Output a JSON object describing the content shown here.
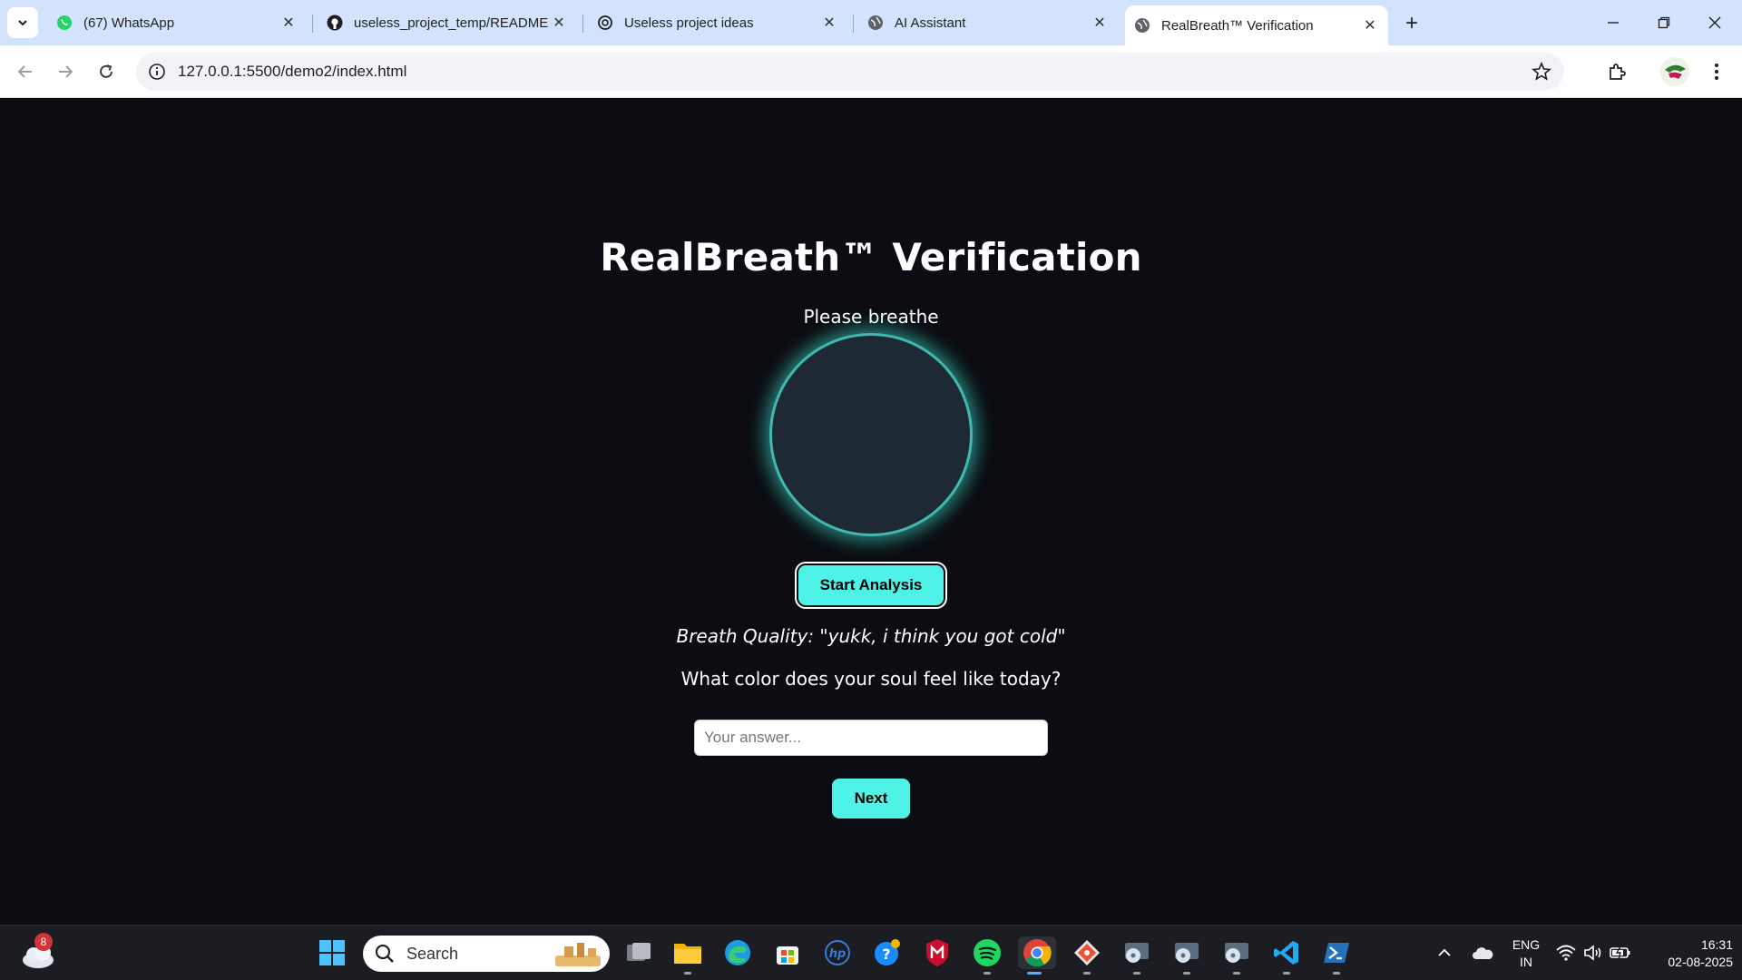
{
  "browser": {
    "tabs": [
      {
        "title": "(67) WhatsApp",
        "icon": "whatsapp-icon"
      },
      {
        "title": "useless_project_temp/README",
        "icon": "github-icon"
      },
      {
        "title": "Useless project ideas",
        "icon": "openai-icon"
      },
      {
        "title": "AI Assistant",
        "icon": "globe-icon"
      },
      {
        "title": "RealBreath™ Verification",
        "icon": "globe-icon",
        "active": true
      }
    ],
    "url": "127.0.0.1:5500/demo2/index.html"
  },
  "page": {
    "title": "RealBreath™ Verification",
    "instruction": "Please breathe",
    "start_button": "Start Analysis",
    "quality_text": "Breath Quality: \"yukk, i think you got cold\"",
    "question": "What color does your soul feel like today?",
    "answer_placeholder": "Your answer...",
    "answer_value": "",
    "next_button": "Next",
    "accent_color": "#4ff2e6",
    "background_color": "#0b0d12"
  },
  "taskbar": {
    "weather_badge": "8",
    "search_label": "Search",
    "language_line1": "ENG",
    "language_line2": "IN",
    "time": "16:31",
    "date": "02-08-2025"
  }
}
